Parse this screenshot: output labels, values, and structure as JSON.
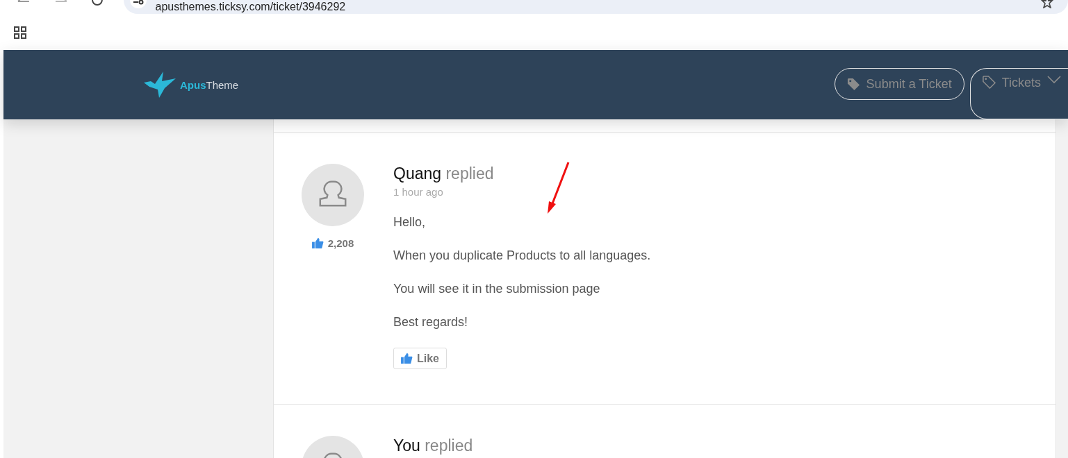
{
  "browser": {
    "address": "apusthemes.ticksy.com/ticket/3946292"
  },
  "header": {
    "logo": {
      "part_1": "Apus",
      "part_2": "Theme"
    },
    "nav": [
      {
        "label": "Submit a Ticket",
        "kind": "filled",
        "dropdown": false
      },
      {
        "label": "Tickets",
        "kind": "outline",
        "dropdown": true
      }
    ]
  },
  "replies": [
    {
      "author": "Quang",
      "verb": "replied",
      "time": "1 hour ago",
      "likes": "2,208",
      "paragraphs": [
        "Hello,",
        "When you duplicate Products to all languages.",
        "You will see it in the submission page",
        "Best regards!"
      ],
      "like_button": "Like"
    },
    {
      "author": "You",
      "verb": "replied"
    }
  ]
}
